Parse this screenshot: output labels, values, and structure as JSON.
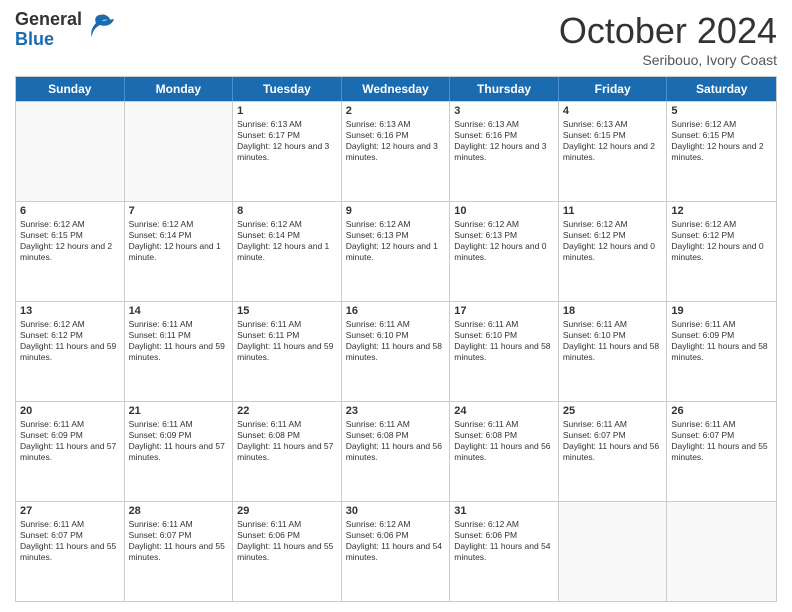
{
  "header": {
    "logo_general": "General",
    "logo_blue": "Blue",
    "month": "October 2024",
    "location": "Seribouo, Ivory Coast"
  },
  "days_of_week": [
    "Sunday",
    "Monday",
    "Tuesday",
    "Wednesday",
    "Thursday",
    "Friday",
    "Saturday"
  ],
  "weeks": [
    [
      {
        "day": "",
        "text": ""
      },
      {
        "day": "",
        "text": ""
      },
      {
        "day": "1",
        "text": "Sunrise: 6:13 AM\nSunset: 6:17 PM\nDaylight: 12 hours and 3 minutes."
      },
      {
        "day": "2",
        "text": "Sunrise: 6:13 AM\nSunset: 6:16 PM\nDaylight: 12 hours and 3 minutes."
      },
      {
        "day": "3",
        "text": "Sunrise: 6:13 AM\nSunset: 6:16 PM\nDaylight: 12 hours and 3 minutes."
      },
      {
        "day": "4",
        "text": "Sunrise: 6:13 AM\nSunset: 6:15 PM\nDaylight: 12 hours and 2 minutes."
      },
      {
        "day": "5",
        "text": "Sunrise: 6:12 AM\nSunset: 6:15 PM\nDaylight: 12 hours and 2 minutes."
      }
    ],
    [
      {
        "day": "6",
        "text": "Sunrise: 6:12 AM\nSunset: 6:15 PM\nDaylight: 12 hours and 2 minutes."
      },
      {
        "day": "7",
        "text": "Sunrise: 6:12 AM\nSunset: 6:14 PM\nDaylight: 12 hours and 1 minute."
      },
      {
        "day": "8",
        "text": "Sunrise: 6:12 AM\nSunset: 6:14 PM\nDaylight: 12 hours and 1 minute."
      },
      {
        "day": "9",
        "text": "Sunrise: 6:12 AM\nSunset: 6:13 PM\nDaylight: 12 hours and 1 minute."
      },
      {
        "day": "10",
        "text": "Sunrise: 6:12 AM\nSunset: 6:13 PM\nDaylight: 12 hours and 0 minutes."
      },
      {
        "day": "11",
        "text": "Sunrise: 6:12 AM\nSunset: 6:12 PM\nDaylight: 12 hours and 0 minutes."
      },
      {
        "day": "12",
        "text": "Sunrise: 6:12 AM\nSunset: 6:12 PM\nDaylight: 12 hours and 0 minutes."
      }
    ],
    [
      {
        "day": "13",
        "text": "Sunrise: 6:12 AM\nSunset: 6:12 PM\nDaylight: 11 hours and 59 minutes."
      },
      {
        "day": "14",
        "text": "Sunrise: 6:11 AM\nSunset: 6:11 PM\nDaylight: 11 hours and 59 minutes."
      },
      {
        "day": "15",
        "text": "Sunrise: 6:11 AM\nSunset: 6:11 PM\nDaylight: 11 hours and 59 minutes."
      },
      {
        "day": "16",
        "text": "Sunrise: 6:11 AM\nSunset: 6:10 PM\nDaylight: 11 hours and 58 minutes."
      },
      {
        "day": "17",
        "text": "Sunrise: 6:11 AM\nSunset: 6:10 PM\nDaylight: 11 hours and 58 minutes."
      },
      {
        "day": "18",
        "text": "Sunrise: 6:11 AM\nSunset: 6:10 PM\nDaylight: 11 hours and 58 minutes."
      },
      {
        "day": "19",
        "text": "Sunrise: 6:11 AM\nSunset: 6:09 PM\nDaylight: 11 hours and 58 minutes."
      }
    ],
    [
      {
        "day": "20",
        "text": "Sunrise: 6:11 AM\nSunset: 6:09 PM\nDaylight: 11 hours and 57 minutes."
      },
      {
        "day": "21",
        "text": "Sunrise: 6:11 AM\nSunset: 6:09 PM\nDaylight: 11 hours and 57 minutes."
      },
      {
        "day": "22",
        "text": "Sunrise: 6:11 AM\nSunset: 6:08 PM\nDaylight: 11 hours and 57 minutes."
      },
      {
        "day": "23",
        "text": "Sunrise: 6:11 AM\nSunset: 6:08 PM\nDaylight: 11 hours and 56 minutes."
      },
      {
        "day": "24",
        "text": "Sunrise: 6:11 AM\nSunset: 6:08 PM\nDaylight: 11 hours and 56 minutes."
      },
      {
        "day": "25",
        "text": "Sunrise: 6:11 AM\nSunset: 6:07 PM\nDaylight: 11 hours and 56 minutes."
      },
      {
        "day": "26",
        "text": "Sunrise: 6:11 AM\nSunset: 6:07 PM\nDaylight: 11 hours and 55 minutes."
      }
    ],
    [
      {
        "day": "27",
        "text": "Sunrise: 6:11 AM\nSunset: 6:07 PM\nDaylight: 11 hours and 55 minutes."
      },
      {
        "day": "28",
        "text": "Sunrise: 6:11 AM\nSunset: 6:07 PM\nDaylight: 11 hours and 55 minutes."
      },
      {
        "day": "29",
        "text": "Sunrise: 6:11 AM\nSunset: 6:06 PM\nDaylight: 11 hours and 55 minutes."
      },
      {
        "day": "30",
        "text": "Sunrise: 6:12 AM\nSunset: 6:06 PM\nDaylight: 11 hours and 54 minutes."
      },
      {
        "day": "31",
        "text": "Sunrise: 6:12 AM\nSunset: 6:06 PM\nDaylight: 11 hours and 54 minutes."
      },
      {
        "day": "",
        "text": ""
      },
      {
        "day": "",
        "text": ""
      }
    ]
  ]
}
